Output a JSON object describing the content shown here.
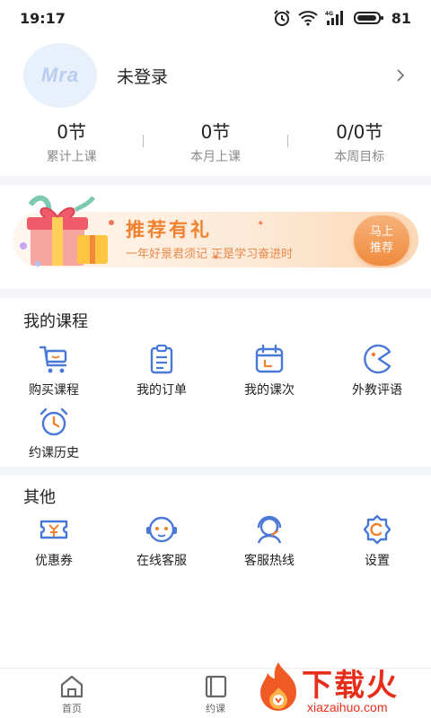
{
  "status": {
    "time": "19:17",
    "battery": "81",
    "network": "4G"
  },
  "profile": {
    "avatar_text": "Mra",
    "username": "未登录"
  },
  "stats": [
    {
      "value": "0节",
      "label": "累计上课"
    },
    {
      "value": "0节",
      "label": "本月上课"
    },
    {
      "value": "0/0节",
      "label": "本周目标"
    }
  ],
  "banner": {
    "title": "推荐有礼",
    "subtitle": "一年好景君须记  正是学习奋进时",
    "button_line1": "马上",
    "button_line2": "推荐"
  },
  "my_courses": {
    "title": "我的课程",
    "items": [
      {
        "label": "购买课程",
        "icon": "cart-icon"
      },
      {
        "label": "我的订单",
        "icon": "clipboard-icon"
      },
      {
        "label": "我的课次",
        "icon": "calendar-icon"
      },
      {
        "label": "外教评语",
        "icon": "comment-icon"
      },
      {
        "label": "约课历史",
        "icon": "alarm-clock-icon"
      }
    ]
  },
  "others": {
    "title": "其他",
    "items": [
      {
        "label": "优惠券",
        "icon": "coupon-icon"
      },
      {
        "label": "在线客服",
        "icon": "chat-bot-icon"
      },
      {
        "label": "客服热线",
        "icon": "headset-icon"
      },
      {
        "label": "设置",
        "icon": "gear-icon"
      }
    ]
  },
  "tabs": [
    {
      "label": "首页",
      "icon": "home-icon"
    },
    {
      "label": "约课",
      "icon": "book-icon"
    }
  ],
  "watermark": {
    "text": "下载火",
    "url": "xiazaihuo.com"
  },
  "colors": {
    "accent_blue": "#4a78d6",
    "banner_orange": "#f0822f",
    "watermark_red": "#e62e1a"
  }
}
